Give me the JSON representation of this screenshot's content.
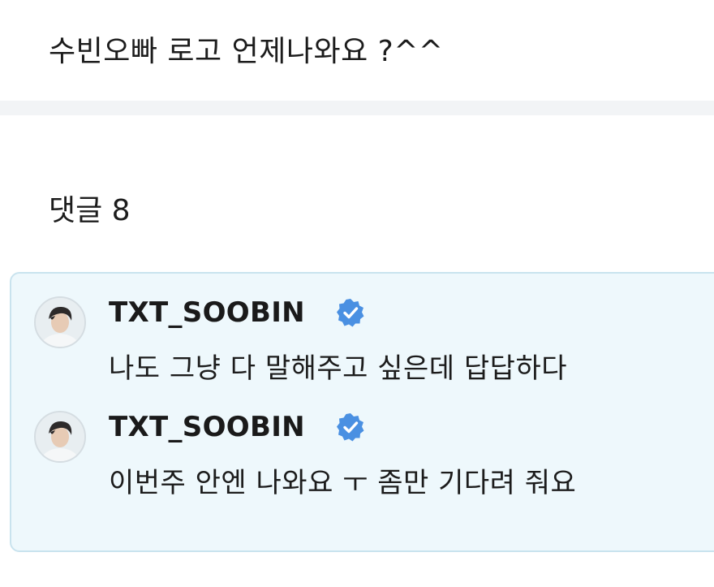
{
  "post": {
    "title": "수빈오빠 로고 언제나와요 ?^^"
  },
  "comments_section": {
    "count_label": "댓글 8"
  },
  "comments": [
    {
      "username": "TXT_SOOBIN",
      "verified_icon": "verified-badge-icon",
      "text": "나도 그냥 다 말해주고 싶은데 답답하다"
    },
    {
      "username": "TXT_SOOBIN",
      "verified_icon": "verified-badge-icon",
      "text": "이번주 안엔 나와요 ㅜ 좀만 기다려 줘요"
    }
  ],
  "colors": {
    "comment_background": "#eef8fc",
    "comment_border": "#c9e3ee",
    "verified_blue": "#4a90e2",
    "divider": "#f2f4f6"
  }
}
